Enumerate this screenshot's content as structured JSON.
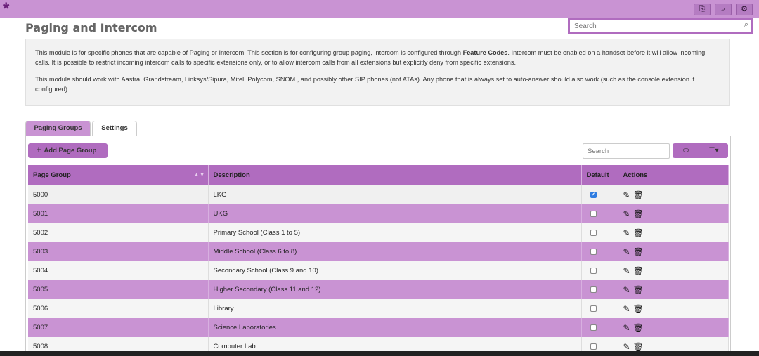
{
  "header": {
    "logo": "*",
    "icons": [
      "translate-icon",
      "search-icon",
      "gear-icon"
    ],
    "icon_glyphs": [
      "⎘",
      "⌕",
      "⚙"
    ],
    "search_placeholder": "Search"
  },
  "page": {
    "title": "Paging and Intercom"
  },
  "info": {
    "p1_before": "This module is for specific phones that are capable of Paging or Intercom. This section is for configuring group paging, intercom is configured through ",
    "p1_bold": "Feature Codes",
    "p1_after": ". Intercom must be enabled on a handset before it will allow incoming calls. It is possible to restrict incoming intercom calls to specific extensions only, or to allow intercom calls from all extensions but explicitly deny from specific extensions.",
    "p2": "This module should work with Aastra, Grandstream, Linksys/Sipura, Mitel, Polycom, SNOM , and possibly other SIP phones (not ATAs). Any phone that is always set to auto-answer should also work (such as the console extension if configured)."
  },
  "tabs": [
    {
      "label": "Paging Groups",
      "active": true
    },
    {
      "label": "Settings",
      "active": false
    }
  ],
  "toolbar": {
    "add_label": "Add Page Group",
    "search_placeholder": "Search",
    "toggle_icon": "toggle-icon",
    "columns_icon": "columns-icon"
  },
  "table": {
    "headers": [
      "Page Group",
      "Description",
      "Default",
      "Actions"
    ],
    "rows": [
      {
        "group": "5000",
        "description": "LKG",
        "default": true
      },
      {
        "group": "5001",
        "description": "UKG",
        "default": false
      },
      {
        "group": "5002",
        "description": "Primary School (Class 1 to 5)",
        "default": false
      },
      {
        "group": "5003",
        "description": "Middle School (Class 6 to 8)",
        "default": false
      },
      {
        "group": "5004",
        "description": "Secondary School (Class 9 and 10)",
        "default": false
      },
      {
        "group": "5005",
        "description": "Higher Secondary (Class 11 and 12)",
        "default": false
      },
      {
        "group": "5006",
        "description": "Library",
        "default": false
      },
      {
        "group": "5007",
        "description": "Science Laboratories",
        "default": false
      },
      {
        "group": "5008",
        "description": "Computer Lab",
        "default": false
      }
    ]
  },
  "colors": {
    "accent": "#b06cbf",
    "accent_light": "#c993d3",
    "checkbox_checked": "#2f7de1"
  }
}
